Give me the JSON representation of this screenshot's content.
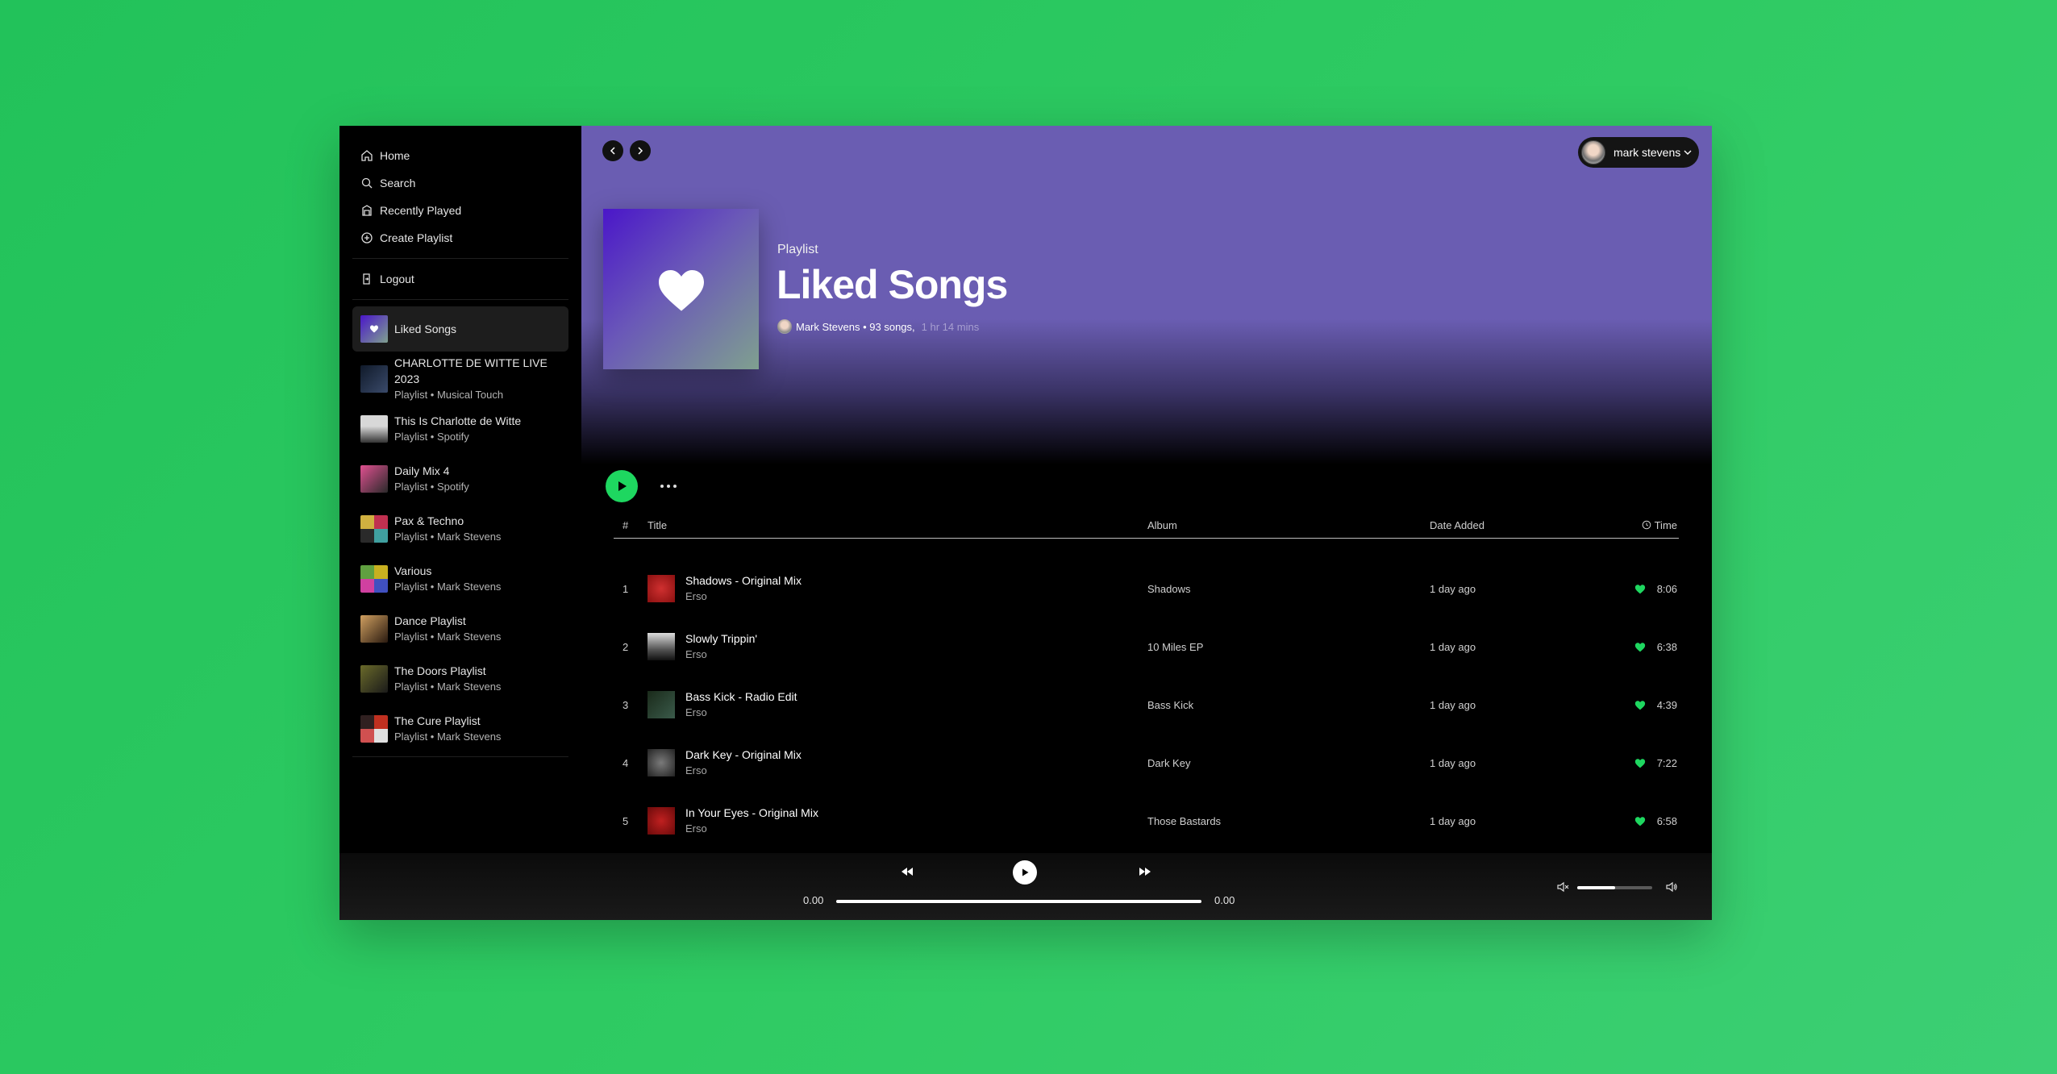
{
  "sidebar": {
    "nav": [
      {
        "label": "Home",
        "icon": "home-icon"
      },
      {
        "label": "Search",
        "icon": "search-icon"
      },
      {
        "label": "Recently Played",
        "icon": "library-icon"
      },
      {
        "label": "Create Playlist",
        "icon": "plus-circle-icon"
      }
    ],
    "logout": {
      "label": "Logout",
      "icon": "logout-icon"
    },
    "playlists": [
      {
        "name": "Liked Songs",
        "sub": "",
        "thumb_colors": [
          "#4a16c9",
          "#7fa08f"
        ]
      },
      {
        "name": "CHARLOTTE DE WITTE LIVE 2023",
        "sub": "Playlist • Musical Touch",
        "thumb_colors": [
          "#101a2a",
          "#3a4a6a"
        ]
      },
      {
        "name": "This Is Charlotte de Witte",
        "sub": "Playlist • Spotify",
        "thumb_colors": [
          "#d8d8d8",
          "#333333"
        ]
      },
      {
        "name": "Daily Mix 4",
        "sub": "Playlist • Spotify",
        "thumb_colors": [
          "#e05090",
          "#2a2a2a"
        ]
      },
      {
        "name": "Pax & Techno",
        "sub": "Playlist • Mark Stevens",
        "thumb_colors": [
          "#c03050",
          "#40a0a0"
        ]
      },
      {
        "name": "Various",
        "sub": "Playlist • Mark Stevens",
        "thumb_colors": [
          "#c8b020",
          "#4050c0"
        ]
      },
      {
        "name": "Dance Playlist",
        "sub": "Playlist • Mark Stevens",
        "thumb_colors": [
          "#d0a060",
          "#2a1a10"
        ]
      },
      {
        "name": "The Doors Playlist",
        "sub": "Playlist • Mark Stevens",
        "thumb_colors": [
          "#6a6a2a",
          "#1a1a1a"
        ]
      },
      {
        "name": "The Cure Playlist",
        "sub": "Playlist • Mark Stevens",
        "thumb_colors": [
          "#c03020",
          "#e0e0e0"
        ]
      }
    ]
  },
  "header": {
    "user_name": "mark stevens"
  },
  "hero": {
    "type": "Playlist",
    "title": "Liked Songs",
    "owner": "Mark Stevens",
    "songs": "• 93 songs,",
    "duration": "1 hr 14 mins"
  },
  "table": {
    "headers": {
      "num": "#",
      "title": "Title",
      "album": "Album",
      "date": "Date Added",
      "time": "Time"
    },
    "rows": [
      {
        "num": "1",
        "title": "Shadows - Original Mix",
        "artist": "Erso",
        "album": "Shadows",
        "date": "1 day ago",
        "time": "8:06",
        "thumb": [
          "#b01818",
          "#d03030"
        ]
      },
      {
        "num": "2",
        "title": "Slowly Trippin'",
        "artist": "Erso",
        "album": "10 Miles EP",
        "date": "1 day ago",
        "time": "6:38",
        "thumb": [
          "#1a1a1a",
          "#9a9a9a"
        ]
      },
      {
        "num": "3",
        "title": "Bass Kick - Radio Edit",
        "artist": "Erso",
        "album": "Bass Kick",
        "date": "1 day ago",
        "time": "4:39",
        "thumb": [
          "#1a2a1a",
          "#3a5a4a"
        ]
      },
      {
        "num": "4",
        "title": "Dark Key - Original Mix",
        "artist": "Erso",
        "album": "Dark Key",
        "date": "1 day ago",
        "time": "7:22",
        "thumb": [
          "#222222",
          "#5a5a5a"
        ]
      },
      {
        "num": "5",
        "title": "In Your Eyes - Original Mix",
        "artist": "Erso",
        "album": "Those Bastards",
        "date": "1 day ago",
        "time": "6:58",
        "thumb": [
          "#8a1010",
          "#c02020"
        ]
      }
    ]
  },
  "player": {
    "elapsed": "0.00",
    "total": "0.00",
    "volume_fraction": 0.5
  },
  "colors": {
    "accent": "#1ed760",
    "hero_bg": "#6a5db2",
    "page_bg": "#2fcb63"
  }
}
